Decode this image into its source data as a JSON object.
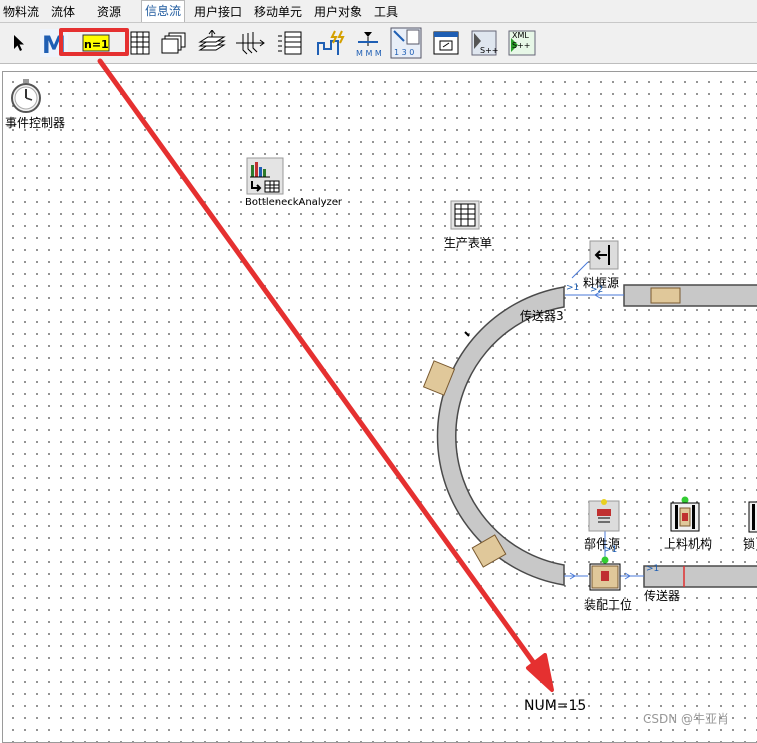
{
  "menu": {
    "tabs": [
      "物料流",
      "流体",
      "资源",
      "信息流",
      "用户接口",
      "移动单元",
      "用户对象",
      "工具"
    ],
    "active_tab": "信息流"
  },
  "toolbar": {
    "tools": [
      {
        "name": "pointer",
        "icon": "arrow-cursor-icon"
      },
      {
        "name": "method",
        "icon": "method-m-icon"
      },
      {
        "name": "variable",
        "icon": "variable-n-icon",
        "label": "n=1"
      },
      {
        "name": "table-file",
        "icon": "table-icon"
      },
      {
        "name": "card-file",
        "icon": "card-file-icon"
      },
      {
        "name": "stack-file",
        "icon": "stack-file-icon"
      },
      {
        "name": "queue-file",
        "icon": "queue-file-icon"
      },
      {
        "name": "trace-file",
        "icon": "list-file-icon"
      },
      {
        "name": "generator",
        "icon": "generator-icon"
      },
      {
        "name": "attribute-explorer",
        "icon": "explorer-icon",
        "label": "M M M"
      },
      {
        "name": "experiment-manager",
        "icon": "experiment-icon",
        "label": "1 3 0"
      },
      {
        "name": "dialog",
        "icon": "dialog-icon"
      },
      {
        "name": "socket",
        "icon": "socket-icon",
        "label": "S++"
      },
      {
        "name": "xml-interface",
        "icon": "xml-icon",
        "label": "XML S++"
      }
    ]
  },
  "model": {
    "event_controller": "事件控制器",
    "bottleneck_analyzer": "BottleneckAnalyzer",
    "production_table": "生产表单",
    "material_source": "料框源",
    "conveyor3": "传送器3",
    "part_source": "部件源",
    "loader": "上料机构",
    "lock": "锁",
    "assembly_station": "装配工位",
    "conveyor": "传送器",
    "connector_marks": [
      ">1",
      ">2",
      ">1",
      ">1"
    ]
  },
  "annotation": {
    "num_text": "NUM=15",
    "watermark": "CSDN @牛亚肖",
    "highlight_color": "#e53030"
  }
}
